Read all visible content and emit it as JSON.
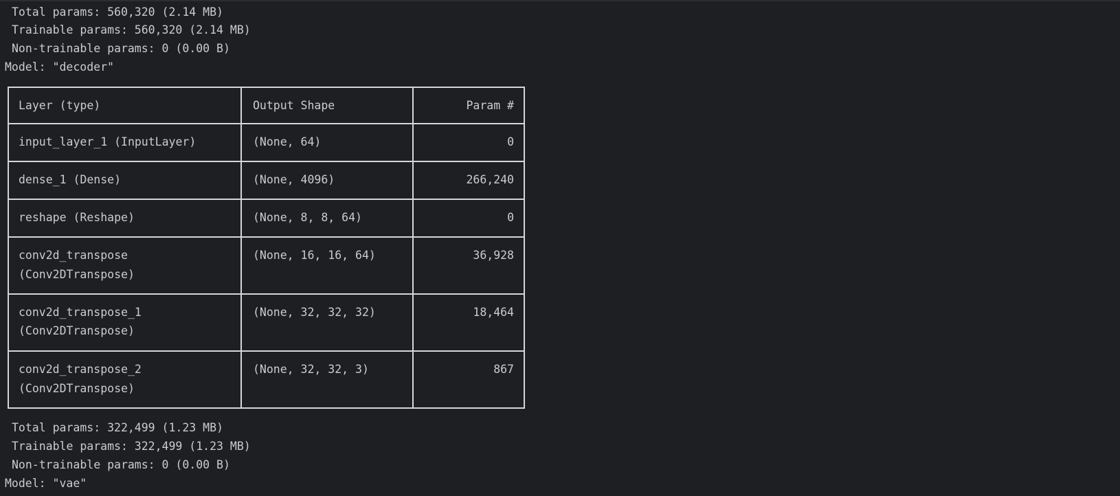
{
  "previous_summary": {
    "total": "Total params: 560,320 (2.14 MB)",
    "trainable": "Trainable params: 560,320 (2.14 MB)",
    "non_trainable": "Non-trainable params: 0 (0.00 B)"
  },
  "decoder": {
    "model_label": "Model: \"decoder\"",
    "headers": {
      "layer": "Layer (type)",
      "output": "Output Shape",
      "params": "Param #"
    },
    "rows": [
      {
        "name": "input_layer_1 (InputLayer)",
        "type": "",
        "output": "(None, 64)",
        "params": "0"
      },
      {
        "name": "dense_1 (Dense)",
        "type": "",
        "output": "(None, 4096)",
        "params": "266,240"
      },
      {
        "name": "reshape (Reshape)",
        "type": "",
        "output": "(None, 8, 8, 64)",
        "params": "0"
      },
      {
        "name": "conv2d_transpose",
        "type": "(Conv2DTranspose)",
        "output": "(None, 16, 16, 64)",
        "params": "36,928"
      },
      {
        "name": "conv2d_transpose_1",
        "type": "(Conv2DTranspose)",
        "output": "(None, 32, 32, 32)",
        "params": "18,464"
      },
      {
        "name": "conv2d_transpose_2",
        "type": "(Conv2DTranspose)",
        "output": "(None, 32, 32, 3)",
        "params": "867"
      }
    ],
    "summary": {
      "total": "Total params: 322,499 (1.23 MB)",
      "trainable": "Trainable params: 322,499 (1.23 MB)",
      "non_trainable": "Non-trainable params: 0 (0.00 B)"
    }
  },
  "next_model_label": "Model: \"vae\""
}
